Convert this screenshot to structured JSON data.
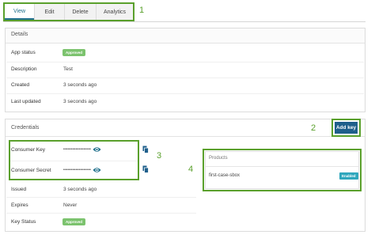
{
  "tabs": [
    {
      "label": "View",
      "active": true
    },
    {
      "label": "Edit",
      "active": false
    },
    {
      "label": "Delete",
      "active": false
    },
    {
      "label": "Analytics",
      "active": false
    }
  ],
  "callouts": {
    "c1": "1",
    "c2": "2",
    "c3": "3",
    "c4": "4"
  },
  "details": {
    "title": "Details",
    "app_status_label": "App status",
    "app_status_value": "Approved",
    "description_label": "Description",
    "description_value": "Test",
    "created_label": "Created",
    "created_value": "3 seconds ago",
    "last_updated_label": "Last updated",
    "last_updated_value": "3 seconds ago"
  },
  "credentials": {
    "title": "Credentials",
    "add_key_label": "Add key",
    "consumer_key_label": "Consumer Key",
    "consumer_key_value": "••••••••••••••••••",
    "consumer_secret_label": "Consumer Secret",
    "consumer_secret_value": "••••••••••••••••••",
    "issued_label": "Issued",
    "issued_value": "3 seconds ago",
    "expires_label": "Expires",
    "expires_value": "Never",
    "key_status_label": "Key Status",
    "key_status_value": "Approved"
  },
  "products": {
    "title": "Products",
    "items": [
      {
        "name": "first-case-sbox",
        "status": "Enabled"
      }
    ]
  },
  "colors": {
    "accent": "#1f5f8b",
    "callout": "#5aa02c",
    "approved": "#7cc36e",
    "enabled": "#2fa7bd"
  },
  "icons": [
    "eye-icon",
    "copy-icon"
  ]
}
